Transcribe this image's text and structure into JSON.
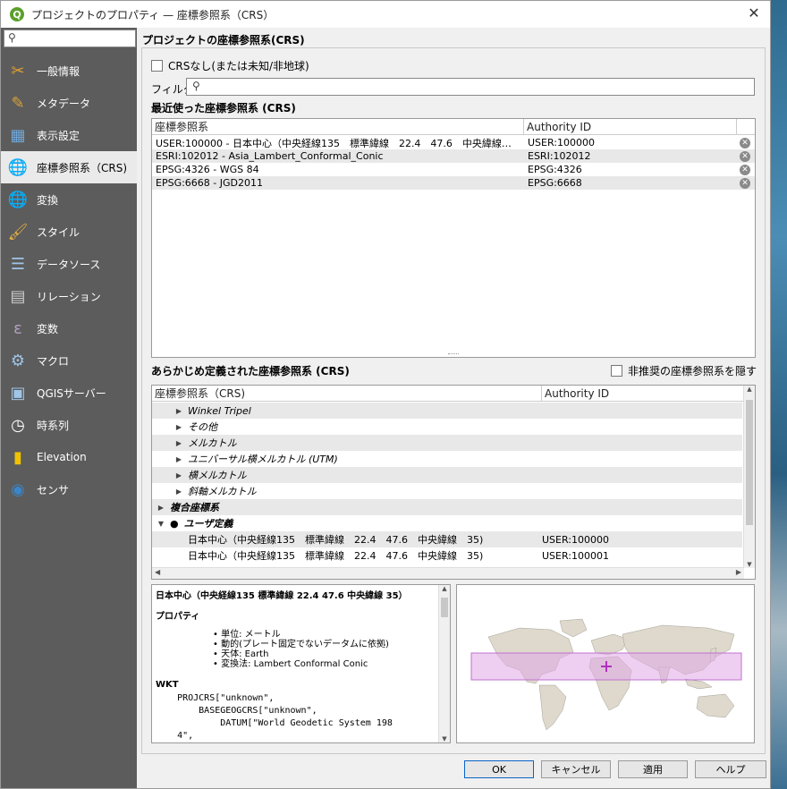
{
  "window": {
    "title": "プロジェクトのプロパティ — 座標参照系（CRS）",
    "close_glyph": "✕",
    "app_icon": "Q"
  },
  "sidebar": {
    "search_placeholder": "",
    "items": [
      {
        "label": "一般情報",
        "icon": "tools-icon",
        "glyph": "✂",
        "color": "#e0a030"
      },
      {
        "label": "メタデータ",
        "icon": "metadata-icon",
        "glyph": "✎",
        "color": "#d9a33a"
      },
      {
        "label": "表示設定",
        "icon": "view-settings-icon",
        "glyph": "▦",
        "color": "#6fa8dc"
      },
      {
        "label": "座標参照系（CRS)",
        "icon": "globe-icon",
        "glyph": "🌐",
        "color": "#2f6fb0",
        "active": true
      },
      {
        "label": "変換",
        "icon": "transform-icon",
        "glyph": "🌐",
        "color": "#3a86c8"
      },
      {
        "label": "スタイル",
        "icon": "brush-icon",
        "glyph": "🖌",
        "color": "#e8b040"
      },
      {
        "label": "データソース",
        "icon": "datasource-icon",
        "glyph": "☰",
        "color": "#9fc5e8"
      },
      {
        "label": "リレーション",
        "icon": "relation-icon",
        "glyph": "▤",
        "color": "#cccccc"
      },
      {
        "label": "変数",
        "icon": "variable-icon",
        "glyph": "ε",
        "color": "#b0a0c0"
      },
      {
        "label": "マクロ",
        "icon": "macro-icon",
        "glyph": "⚙",
        "color": "#9fc5e8"
      },
      {
        "label": "QGISサーバー",
        "icon": "server-icon",
        "glyph": "▣",
        "color": "#9fc5e8"
      },
      {
        "label": "時系列",
        "icon": "clock-icon",
        "glyph": "◷",
        "color": "#ffffff"
      },
      {
        "label": "Elevation",
        "icon": "elevation-icon",
        "glyph": "▮",
        "color": "#f2c200"
      },
      {
        "label": "センサ",
        "icon": "sensor-icon",
        "glyph": "◉",
        "color": "#3a86c8"
      }
    ]
  },
  "crs": {
    "section_title": "プロジェクトの座標参照系(CRS)",
    "no_crs_label": "CRSなし(または未知/非地球)",
    "filter_label": "フィルタ",
    "filter_value": "",
    "recent_title": "最近使った座標参照系 (CRS)",
    "recent_headers": [
      "座標参照系",
      "Authority ID"
    ],
    "recent_rows": [
      {
        "name": "USER:100000 - 日本中心（中央経線135　標準緯線　22.4　47.6　中央緯線…",
        "id": "USER:100000"
      },
      {
        "name": "ESRI:102012 - Asia_Lambert_Conformal_Conic",
        "id": "ESRI:102012"
      },
      {
        "name": "EPSG:4326 - WGS 84",
        "id": "EPSG:4326"
      },
      {
        "name": "EPSG:6668 - JGD2011",
        "id": "EPSG:6668"
      }
    ],
    "predefined_title": "あらかじめ定義された座標参照系 (CRS)",
    "hide_deprecated_label": "非推奨の座標参照系を隠す",
    "predefined_headers": [
      "座標参照系（CRS)",
      "Authority ID"
    ],
    "tree_rows": [
      {
        "label": "Winkel Tripel",
        "indent": 2,
        "arrow": "▶"
      },
      {
        "label": "その他",
        "indent": 2,
        "arrow": "▶"
      },
      {
        "label": "メルカトル",
        "indent": 2,
        "arrow": "▶"
      },
      {
        "label": "ユニバーサル横メルカトル (UTM)",
        "indent": 2,
        "arrow": "▶"
      },
      {
        "label": "横メルカトル",
        "indent": 2,
        "arrow": "▶"
      },
      {
        "label": "斜軸メルカトル",
        "indent": 2,
        "arrow": "▶"
      },
      {
        "label": "複合座標系",
        "indent": 1,
        "arrow": "▶"
      },
      {
        "label": "ユーザ定義",
        "indent": 1,
        "arrow": "▼",
        "user": true
      },
      {
        "label": "日本中心（中央経線135　標準緯線　22.4　47.6　中央緯線　35)",
        "indent": 3,
        "id": "USER:100000",
        "plain": true
      },
      {
        "label": "日本中心（中央経線135　標準緯線　22.4　47.6　中央緯線　35)",
        "indent": 3,
        "id": "USER:100001",
        "plain": true
      }
    ],
    "info": {
      "heading": "日本中心（中央経線135 標準緯線 22.4 47.6 中央緯線 35）",
      "props_title": "プロパティ",
      "props": [
        "• 単位: メートル",
        "• 動的(プレート固定でないデータムに依拠)",
        "• 天体: Earth",
        "• 変換法: Lambert Conformal Conic"
      ],
      "wkt_title": "WKT",
      "wkt_lines": [
        "    PROJCRS[\"unknown\",",
        "        BASEGEOGCRS[\"unknown\",",
        "            DATUM[\"World Geodetic System 198",
        "    4\","
      ]
    }
  },
  "buttons": {
    "ok": "OK",
    "cancel": "キャンセル",
    "apply": "適用",
    "help": "ヘルプ"
  },
  "colors": {
    "sidebar_bg": "#5c5c5c",
    "extent_fill": "#e0a8e8",
    "extent_stroke": "#c070d0",
    "land": "#ded9cc"
  }
}
